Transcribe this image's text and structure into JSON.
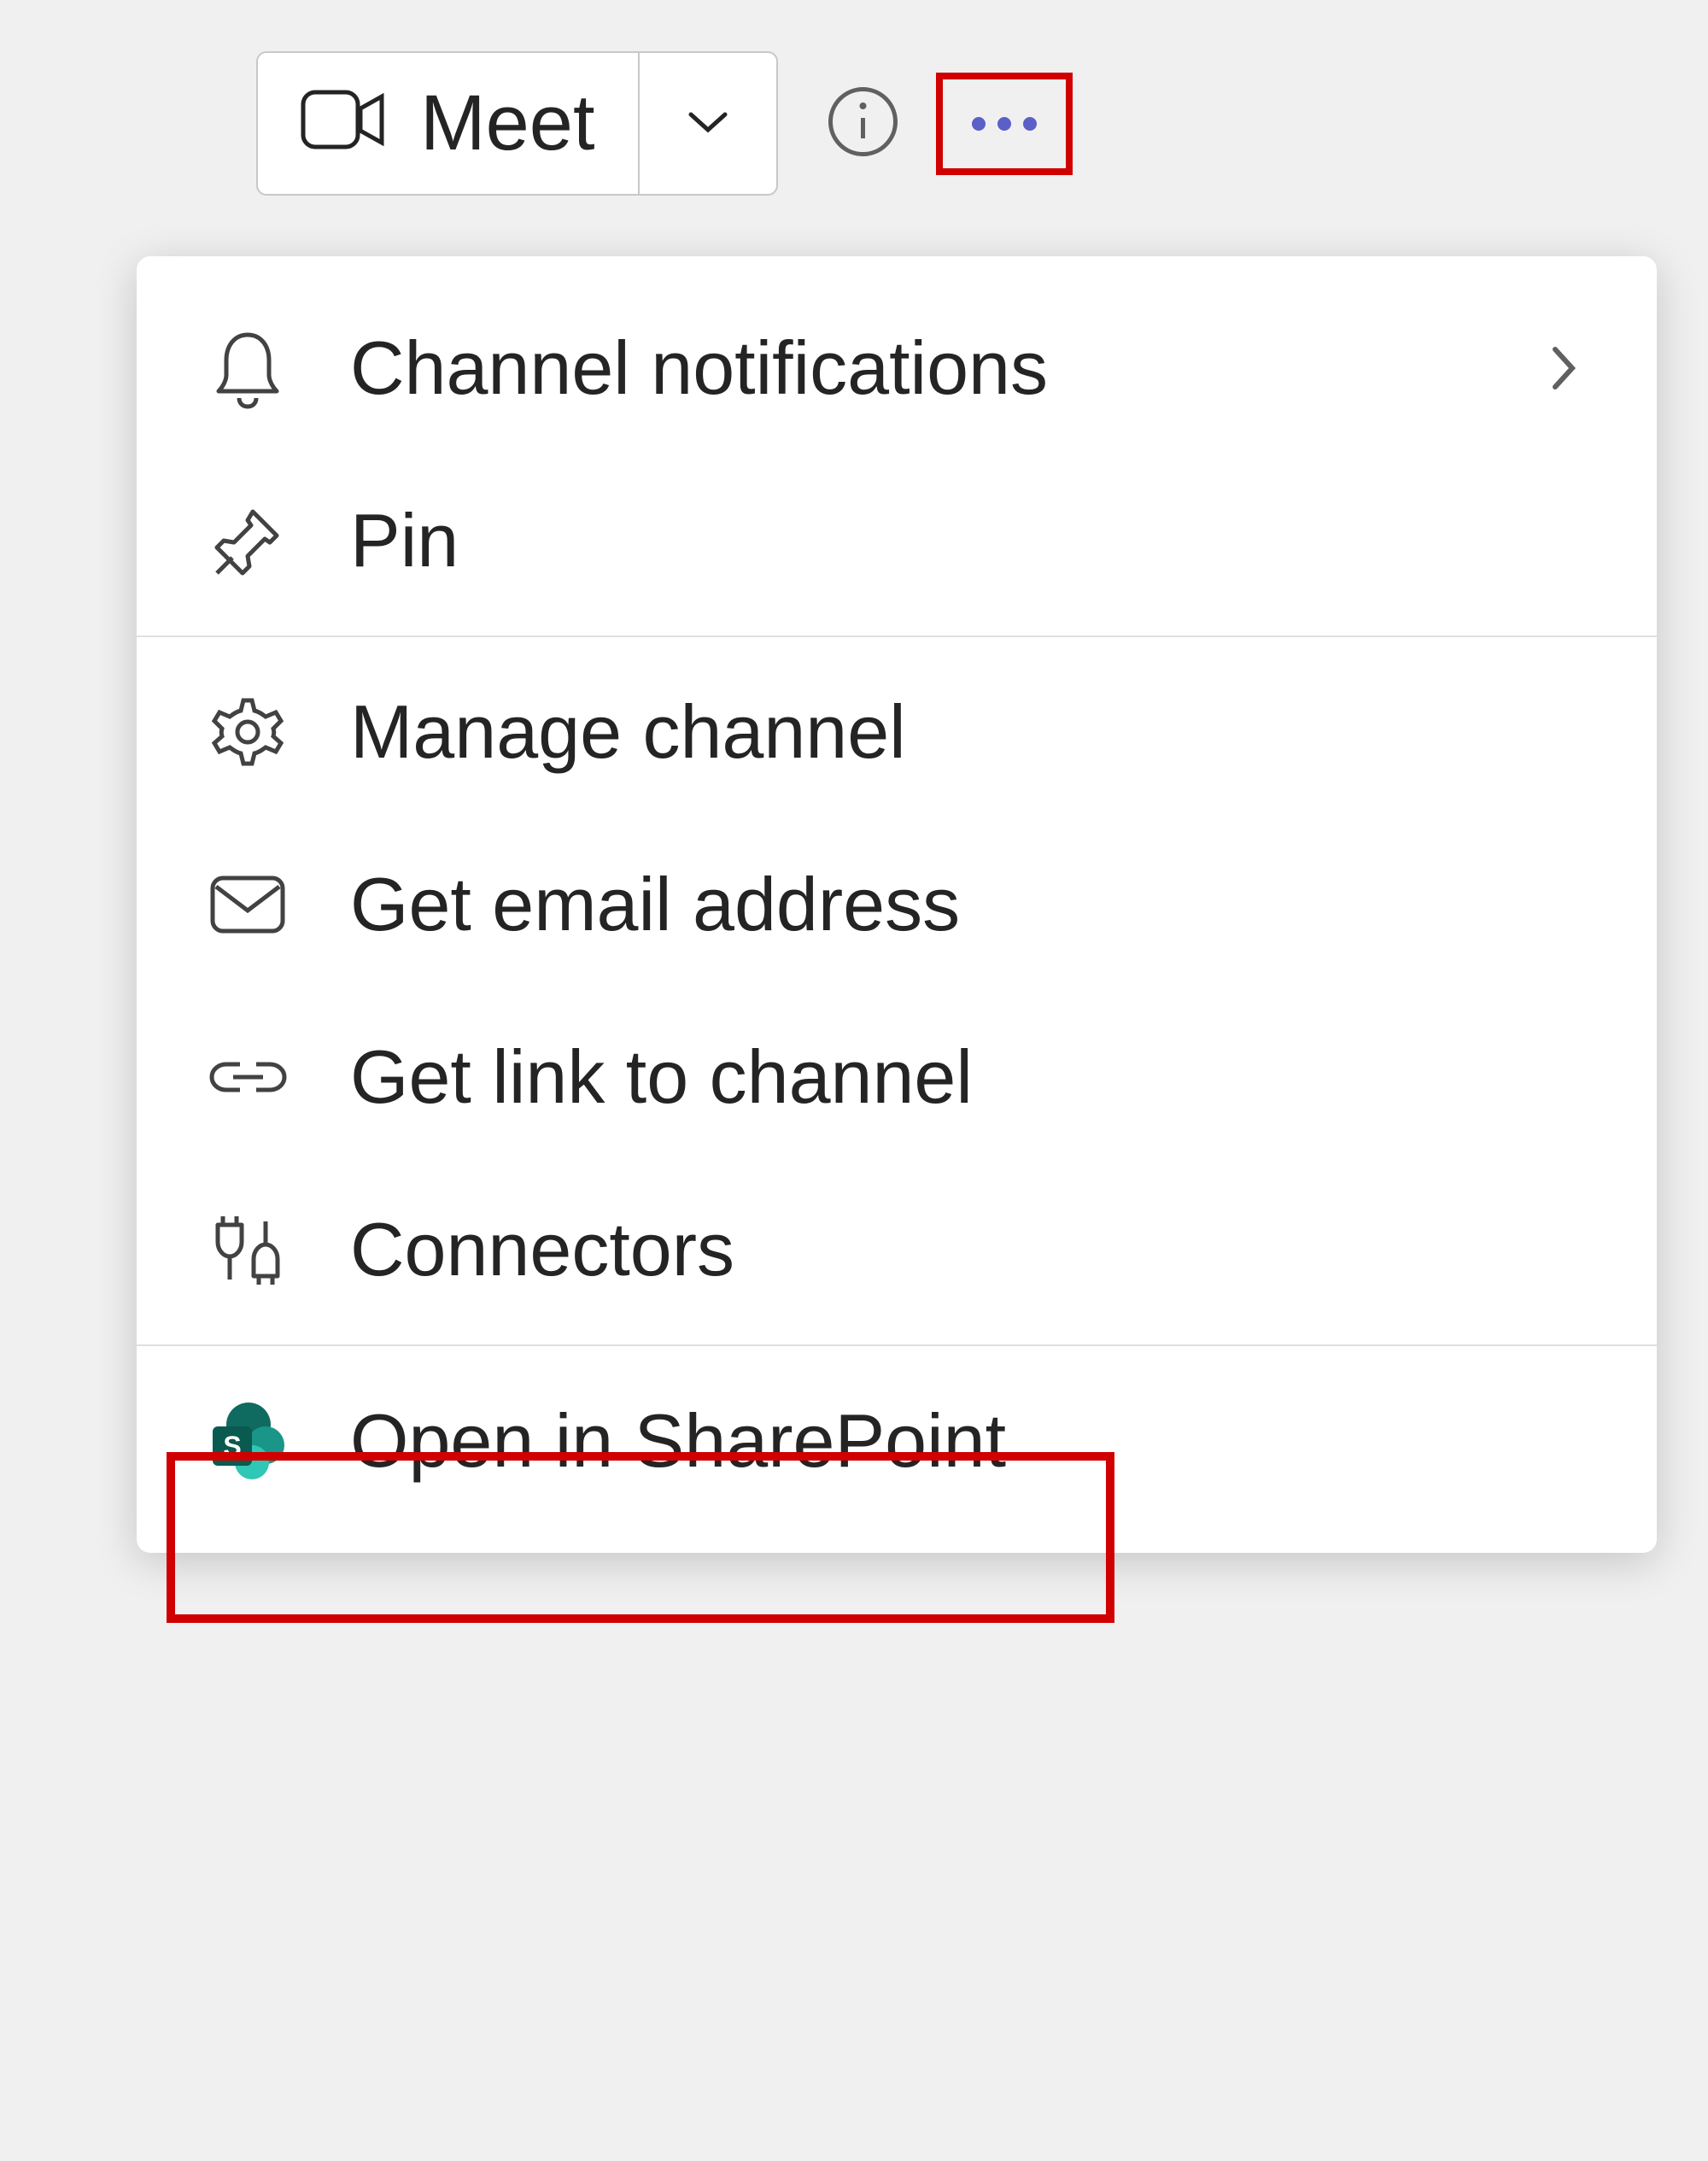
{
  "toolbar": {
    "meet_label": "Meet"
  },
  "menu": {
    "channel_notifications": "Channel notifications",
    "pin": "Pin",
    "manage_channel": "Manage channel",
    "get_email_address": "Get email address",
    "get_link_to_channel": "Get link to channel",
    "connectors": "Connectors",
    "open_in_sharepoint": "Open in SharePoint"
  }
}
